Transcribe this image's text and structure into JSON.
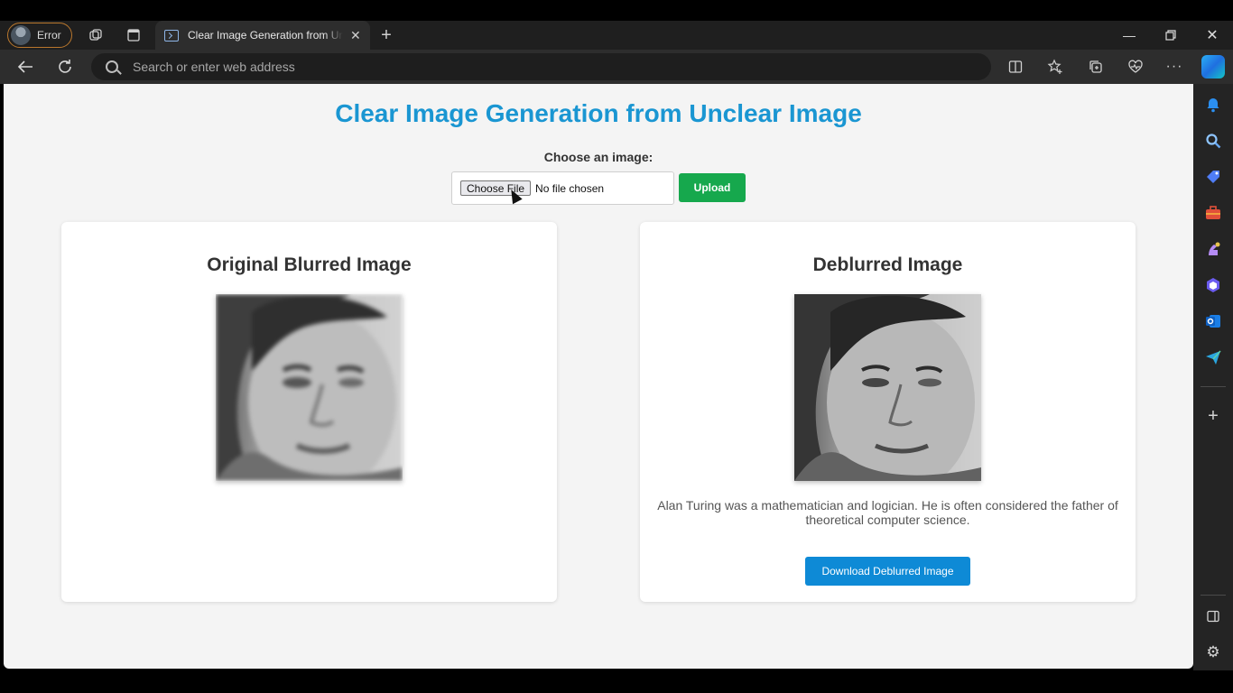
{
  "browser": {
    "profile_label": "Error",
    "tab_title": "Clear Image Generation from Unclear Image",
    "address_placeholder": "Search or enter web address"
  },
  "page": {
    "title": "Clear Image Generation from Unclear Image",
    "choose_label": "Choose an image:",
    "file_button": "Choose File",
    "file_status": "No file chosen",
    "upload_button": "Upload",
    "original_title": "Original Blurred Image",
    "deblurred_title": "Deblurred Image",
    "description": "Alan Turing was a mathematician and logician. He is often considered the father of theoretical computer science.",
    "download_button": "Download Deblurred Image"
  },
  "colors": {
    "title": "#1a96d2",
    "upload": "#16a84d",
    "download": "#0e8ad6"
  }
}
